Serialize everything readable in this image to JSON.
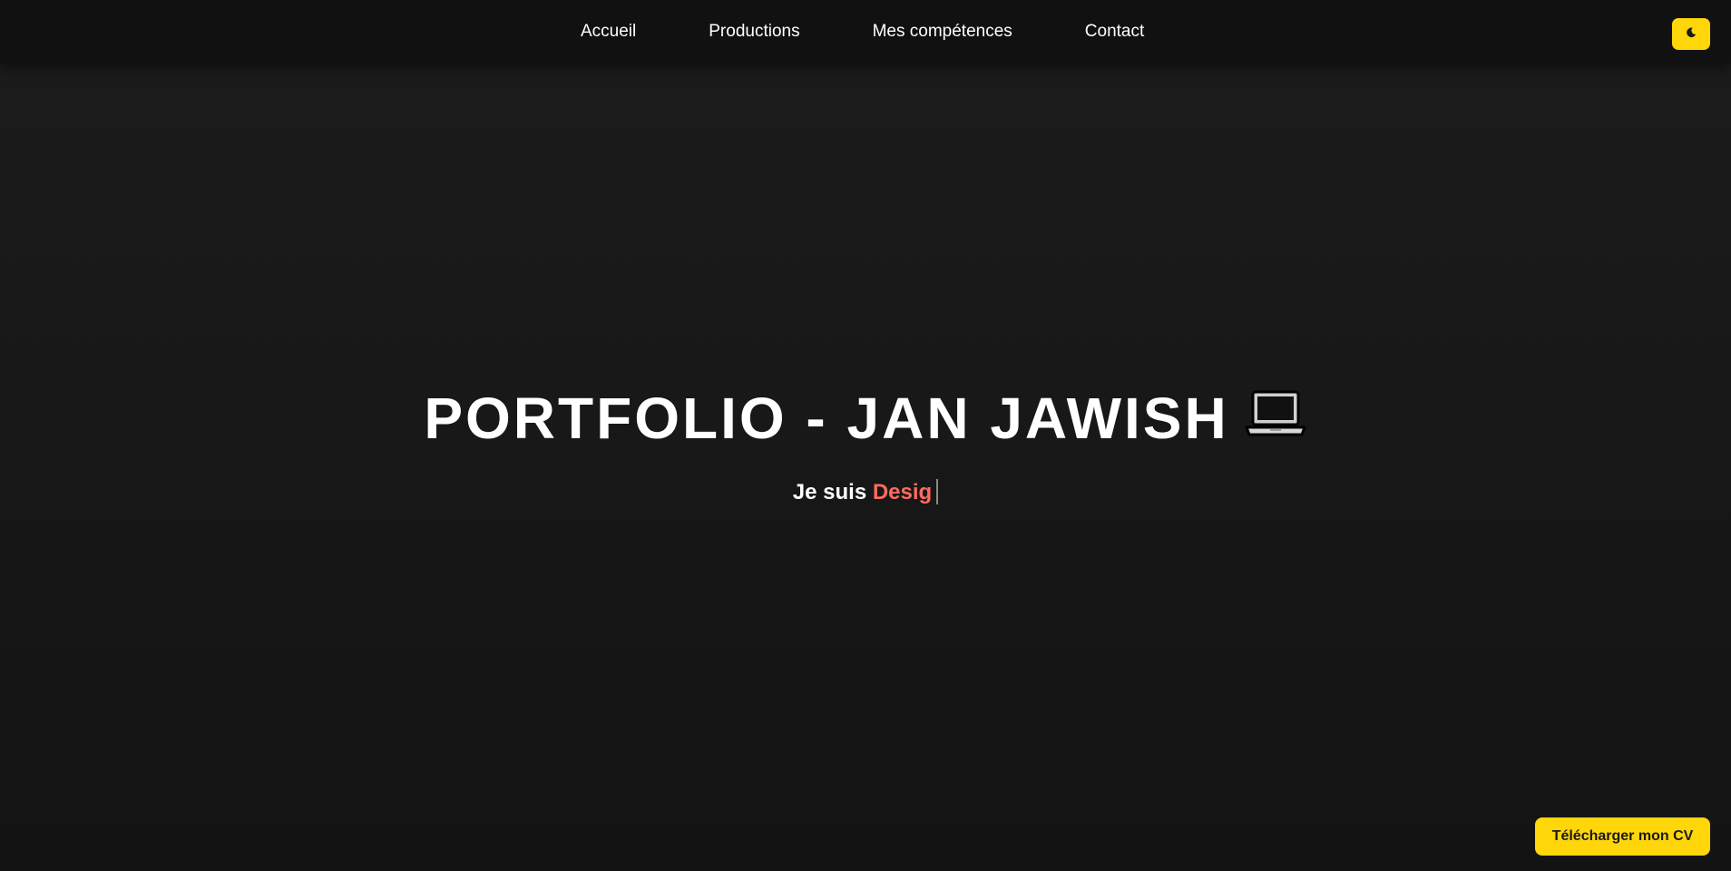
{
  "nav": {
    "items": [
      {
        "label": "Accueil"
      },
      {
        "label": "Productions"
      },
      {
        "label": "Mes compétences"
      },
      {
        "label": "Contact"
      }
    ],
    "theme_toggle_icon": "moon-icon"
  },
  "hero": {
    "title": "PORTFOLIO - JAN JAWISH",
    "title_icon": "laptop-icon",
    "subtitle_prefix": "Je suis",
    "typed_text": "Desig"
  },
  "cv_button": {
    "label": "Télécharger mon CV"
  },
  "colors": {
    "background": "#1a1a1a",
    "navbar": "#111111",
    "accent_yellow": "#ffd60a",
    "typed_accent": "#ff6b5e",
    "text": "#ffffff"
  }
}
